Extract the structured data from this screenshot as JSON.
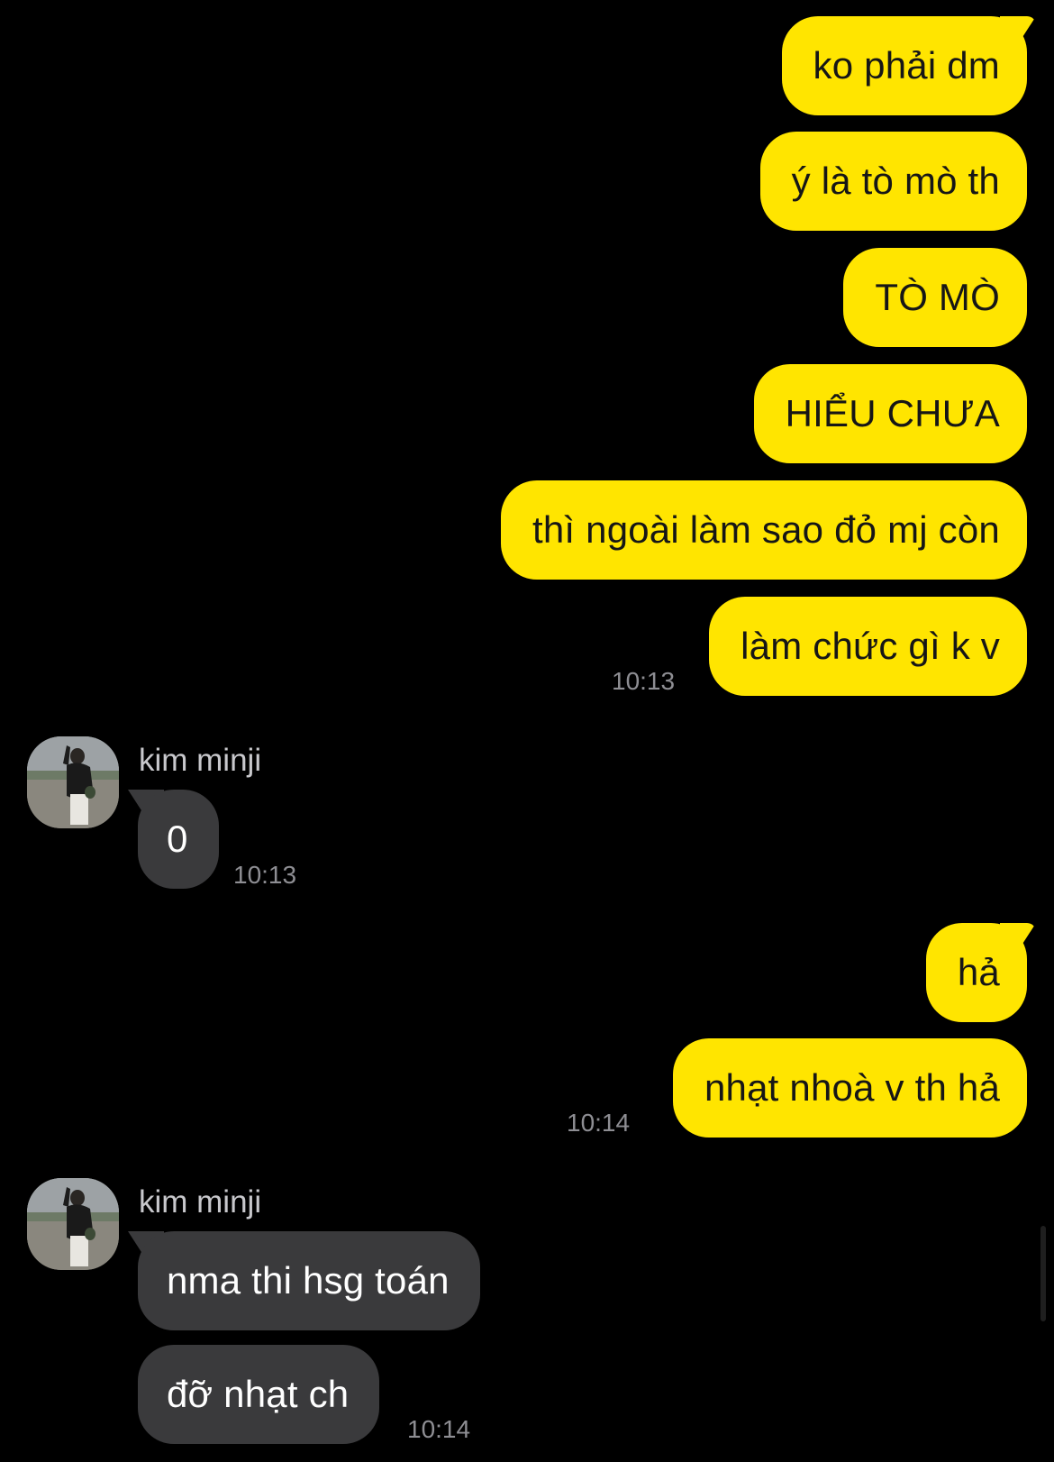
{
  "conversation": {
    "outgoing_block_1": {
      "messages": [
        "ko phải dm",
        "ý là tò mò th",
        "TÒ MÒ",
        "HIỂU CHƯA",
        "thì ngoài làm sao đỏ mj còn",
        "làm chức gì k v"
      ],
      "time": "10:13"
    },
    "incoming_block_1": {
      "sender": "kim minji",
      "messages": [
        "0"
      ],
      "time": "10:13"
    },
    "outgoing_block_2": {
      "messages": [
        "hả",
        "nhạt nhoà v th hả"
      ],
      "time": "10:14"
    },
    "incoming_block_2": {
      "sender": "kim minji",
      "messages": [
        "nma thi hsg toán",
        "đỡ nhạt ch"
      ],
      "time": "10:14"
    }
  },
  "colors": {
    "background": "#000000",
    "outgoing_bubble": "#FFE500",
    "incoming_bubble": "#3A3A3C",
    "timestamp": "#8E8E93"
  },
  "icons": {
    "avatar": "user-photo-avatar"
  }
}
